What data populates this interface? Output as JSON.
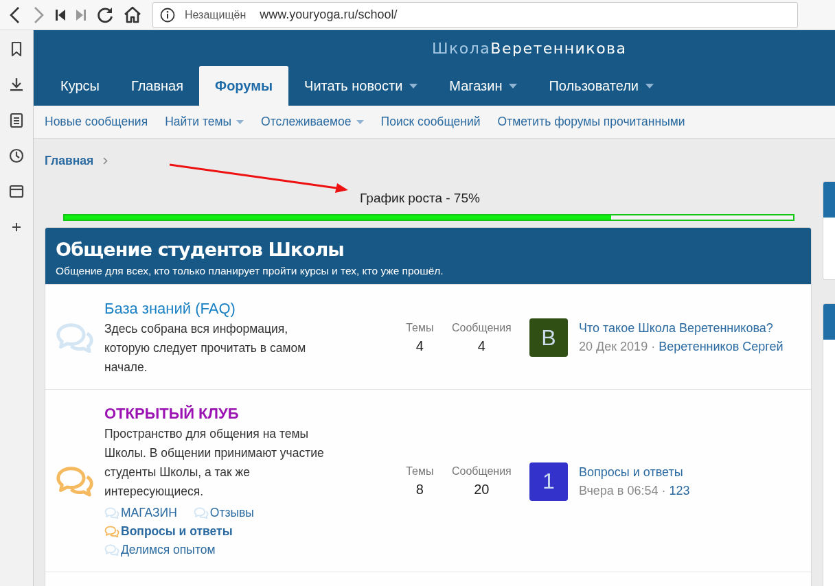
{
  "browser": {
    "security": "Незащищён",
    "url": "www.youryoga.ru/school/"
  },
  "site": {
    "logo": {
      "first": "Школа",
      "second": "Веретенникова"
    },
    "nav_tabs": [
      {
        "label": "Курсы",
        "selected": false,
        "dropdown": false
      },
      {
        "label": "Главная",
        "selected": false,
        "dropdown": false
      },
      {
        "label": "Форумы",
        "selected": true,
        "dropdown": false
      },
      {
        "label": "Читать новости",
        "selected": false,
        "dropdown": true
      },
      {
        "label": "Магазин",
        "selected": false,
        "dropdown": true
      },
      {
        "label": "Пользователи",
        "selected": false,
        "dropdown": true
      }
    ],
    "subnav": [
      {
        "label": "Новые сообщения",
        "dropdown": false
      },
      {
        "label": "Найти темы",
        "dropdown": true
      },
      {
        "label": "Отслеживаемое",
        "dropdown": true
      },
      {
        "label": "Поиск сообщений",
        "dropdown": false
      },
      {
        "label": "Отметить форумы прочитанными",
        "dropdown": false
      }
    ],
    "breadcrumb": [
      "Главная"
    ],
    "progress": {
      "label": "График роста - 75%",
      "level": 0.75
    },
    "category": {
      "title": "Общение студентов Школы",
      "description": "Общение для всех, кто только планирует пройти курсы и тех, кто уже прошёл.",
      "forums": [
        {
          "title": "База знаний (FAQ)",
          "color": "#1a80c4",
          "unread": false,
          "description": "Здесь собрана вся информация, которую следует прочитать в самом начале.",
          "stats": [
            {
              "label": "Темы",
              "value": "4"
            },
            {
              "label": "Сообщения",
              "value": "4"
            }
          ],
          "last_post": {
            "avatar": "B",
            "color": "#2f4f15",
            "title": "Что такое Школа Веретенникова?",
            "date": "20 Дек 2019",
            "separator": "·",
            "author": "Веретенников Сергей"
          }
        },
        {
          "title": "ОТКРЫТЫЙ КЛУБ",
          "color": "#9b12b3",
          "unread": true,
          "description": "Пространство для общения на темы Школы. В общении принимают участие студенты Школы, а так же интересующиеся.",
          "stats": [
            {
              "label": "Темы",
              "value": "8"
            },
            {
              "label": "Сообщения",
              "value": "20"
            }
          ],
          "last_post": {
            "avatar": "1",
            "color": "#3333cc",
            "title": "Вопросы и ответы",
            "date": "Вчера в 06:54",
            "separator": "·",
            "author": "123"
          },
          "subforums": [
            {
              "label": "МАГАЗИН",
              "unread": false
            },
            {
              "label": "Отзывы",
              "unread": false
            },
            {
              "label": "Вопросы и ответы",
              "unread": true
            },
            {
              "label": "Делимся опытом",
              "unread": false
            }
          ]
        }
      ]
    }
  }
}
